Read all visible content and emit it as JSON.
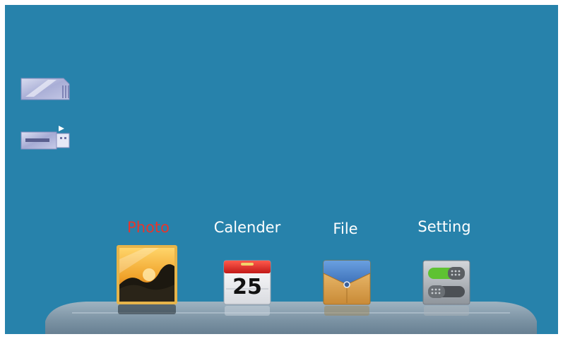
{
  "menu": {
    "items": [
      {
        "label": "Photo",
        "icon": "photo-icon",
        "active": true
      },
      {
        "label": "Calender",
        "icon": "calendar-icon",
        "active": false
      },
      {
        "label": "File",
        "icon": "file-folder-icon",
        "active": false
      },
      {
        "label": "Setting",
        "icon": "settings-toggle-icon",
        "active": false
      }
    ],
    "calendar_day": "25"
  },
  "sources": [
    {
      "icon": "sd-card-icon"
    },
    {
      "icon": "usb-drive-icon"
    }
  ],
  "colors": {
    "background": "#2782ab",
    "active_label": "#e8352c",
    "label": "#ffffff"
  }
}
